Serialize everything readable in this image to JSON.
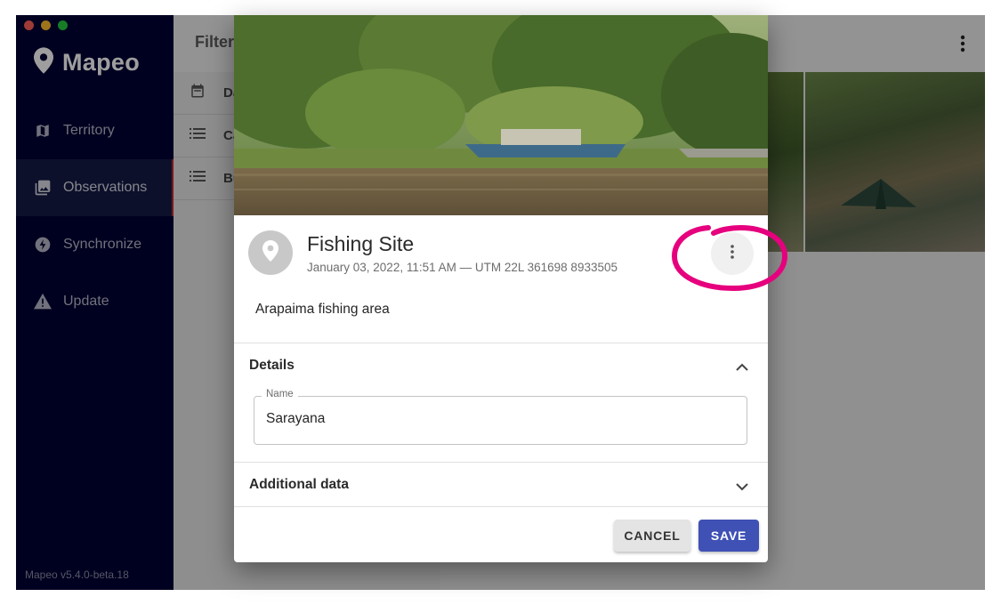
{
  "window": {
    "traffic_lights": [
      "#fe5f57",
      "#febc2e",
      "#28c840"
    ]
  },
  "sidebar": {
    "brand": "Mapeo",
    "items": [
      {
        "label": "Territory",
        "icon": "map-icon",
        "active": false
      },
      {
        "label": "Observations",
        "icon": "photo-library-icon",
        "active": true
      },
      {
        "label": "Synchronize",
        "icon": "sync-bolt-icon",
        "active": false
      },
      {
        "label": "Update",
        "icon": "warning-icon",
        "active": false
      }
    ],
    "version": "Mapeo v5.4.0-beta.18"
  },
  "main": {
    "filter_title": "Filter",
    "filters": [
      {
        "label": "Da",
        "icon": "calendar-icon"
      },
      {
        "label": "Ca",
        "icon": "list-icon"
      },
      {
        "label": "Bu",
        "icon": "list-icon"
      }
    ]
  },
  "dialog": {
    "title": "Fishing Site",
    "subtitle": "January 03, 2022, 11:51 AM — UTM 22L 361698 8933505",
    "description": "Arapaima fishing area",
    "details_section": {
      "title": "Details",
      "expanded": true,
      "name_field": {
        "label": "Name",
        "value": "Sarayana"
      }
    },
    "additional_section": {
      "title": "Additional data",
      "expanded": false
    },
    "actions": {
      "cancel": "CANCEL",
      "save": "SAVE"
    }
  },
  "colors": {
    "sidebar_bg": "#000034",
    "primary": "#3f51b5",
    "annotation": "#e6007e",
    "active_indicator": "#c62828"
  }
}
